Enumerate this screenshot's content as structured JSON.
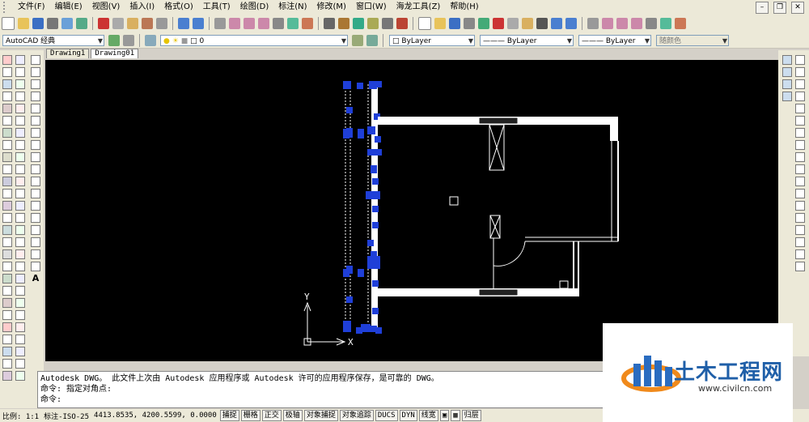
{
  "menu": [
    "文件(F)",
    "编辑(E)",
    "视图(V)",
    "插入(I)",
    "格式(O)",
    "工具(T)",
    "绘图(D)",
    "标注(N)",
    "修改(M)",
    "窗口(W)",
    "海龙工具(Z)",
    "帮助(H)"
  ],
  "toolbar": {
    "workspace": "AutoCAD 经典",
    "layer": "0",
    "color": "ByLayer",
    "linetype": "ByLayer",
    "lineweight": "ByLayer",
    "plotstyle": "随颜色"
  },
  "tabs": [
    "Drawing1",
    "Drawing01"
  ],
  "ucs": {
    "x": "X",
    "y": "Y"
  },
  "command": {
    "history1": "Autodesk DWG。  此文件上次由 Autodesk 应用程序或 Autodesk 许可的应用程序保存，是可靠的 DWG。",
    "history2": "命令: 指定对角点:",
    "prompt": "命令:"
  },
  "status": {
    "scale": "比例: 1:1",
    "dimstyle": "标注-ISO-25",
    "coords": "4413.8535,  4200.5599,  0.0000",
    "buttons": [
      "捕捉",
      "栅格",
      "正交",
      "极轴",
      "对象捕捉",
      "对象追踪",
      "DUCS",
      "DYN",
      "线宽",
      "归层"
    ]
  },
  "watermark": {
    "name": "土木工程网",
    "url": "www.civilcn.com"
  },
  "colors": {
    "selection": "#1f3fd8",
    "canvas": "#000000",
    "brand": "#1f5fa8"
  }
}
